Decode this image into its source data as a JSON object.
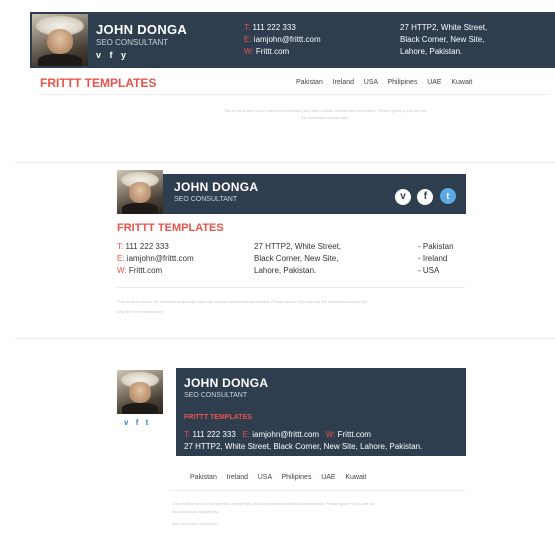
{
  "sig1": {
    "name": "JOHN DONGA",
    "title": "SEO CONSULTANT",
    "social": [
      "v",
      "f",
      "y"
    ],
    "phone_label": "T:",
    "phone": "111 222 333",
    "email_label": "E:",
    "email": "iamjohn@frittt.com",
    "web_label": "W:",
    "web": "Frittt.com",
    "address": [
      "27 HTTP2, White Street,",
      "Black Corner, New Site,",
      "Lahore, Pakistan."
    ],
    "brand": "FRITTT TEMPLATES",
    "countries": [
      "Pakistan",
      "Ireland",
      "USA",
      "Philipines",
      "UAE",
      "Kuwait"
    ],
    "disclaimer": [
      "This email is sent to the intended recipient(s) and may contain confidential information. Please ignore if you are not",
      "the addressed recipient(s)."
    ]
  },
  "sig2": {
    "name": "JOHN DONGA",
    "title": "SEO CONSULTANT",
    "brand": "FRITTT TEMPLATES",
    "phone_label": "T:",
    "phone": "111 222 333",
    "email_label": "E:",
    "email": "iamjohn@frittt.com",
    "web_label": "W:",
    "web": "Frittt.com",
    "address": [
      "27 HTTP2, White Street,",
      "Black Corner, New Site,",
      "Lahore, Pakistan."
    ],
    "countries": [
      "- Pakistan",
      "- Ireland",
      "- USA"
    ],
    "disclaimer": [
      "This email is sent to the intended recipient(s) and may contain confidential information. Please ignore if you are not the addressed recipient(s).",
      "Why are these necessary?"
    ]
  },
  "sig3": {
    "name": "JOHN DONGA",
    "title": "SEO CONSULTANT",
    "brand": "FRITTT TEMPLATES",
    "social": [
      "v",
      "f",
      "t"
    ],
    "phone_label": "T:",
    "phone": "111 222 333",
    "email_label": "E:",
    "email": "iamjohn@frittt.com",
    "web_label": "W:",
    "web": "Frittt.com",
    "address_line": "27 HTTP2, White Street, Black Corner, New Site, Lahore, Pakistan.",
    "countries": [
      "Pakistan",
      "Ireland",
      "USA",
      "Philipines",
      "UAE",
      "Kuwait"
    ],
    "disclaimer": [
      "This email is sent to the intended recipient(s) and may contain confidential information. Please ignore if you are not",
      "the addressed recipient(s).",
      "Why are these necessary?"
    ]
  }
}
